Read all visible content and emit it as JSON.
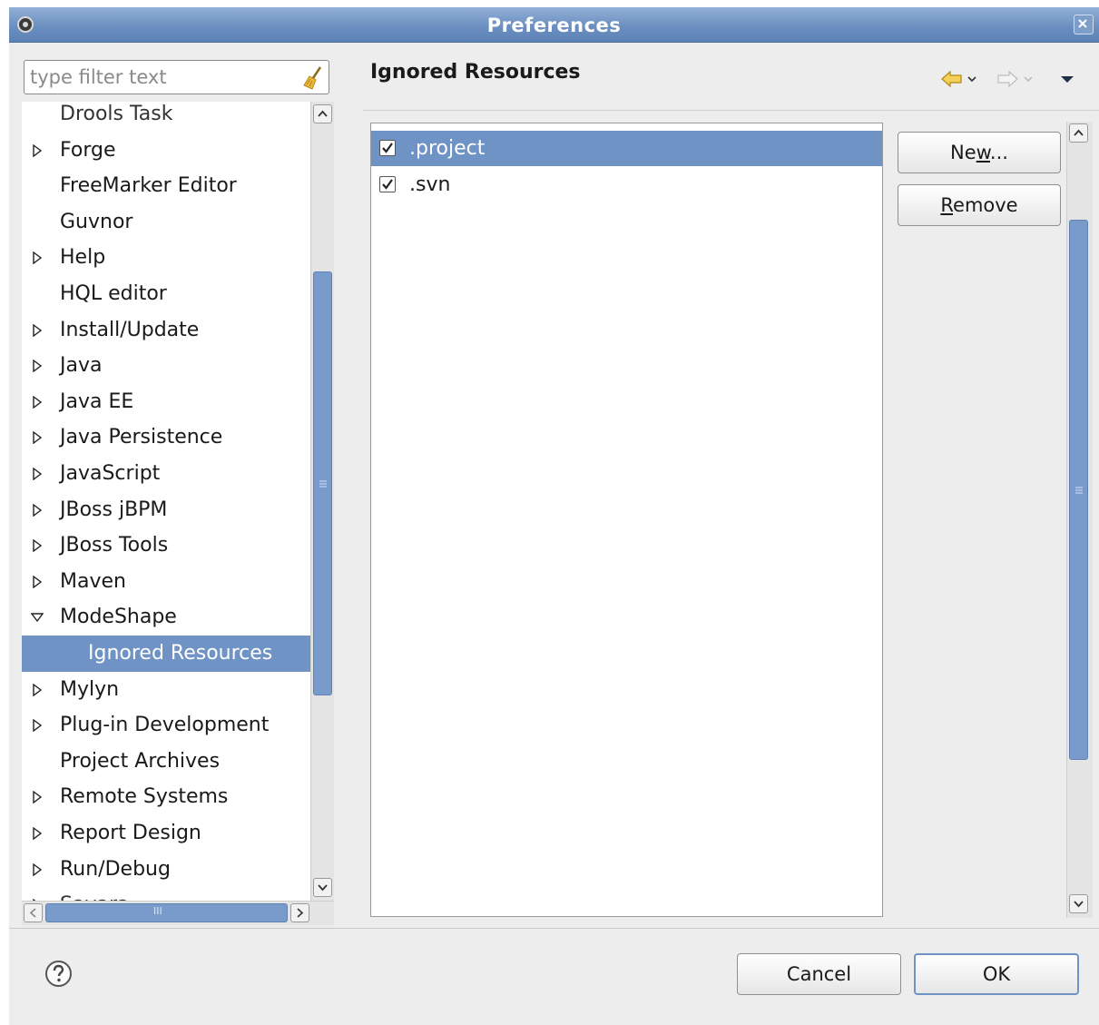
{
  "window": {
    "title": "Preferences"
  },
  "filter": {
    "placeholder": "type filter text"
  },
  "tree": {
    "items": [
      {
        "label": "Drools Task",
        "expander": "none",
        "state": "clipped-top"
      },
      {
        "label": "Forge",
        "expander": "collapsed"
      },
      {
        "label": "FreeMarker Editor",
        "expander": "none"
      },
      {
        "label": "Guvnor",
        "expander": "none"
      },
      {
        "label": "Help",
        "expander": "collapsed"
      },
      {
        "label": "HQL editor",
        "expander": "none"
      },
      {
        "label": "Install/Update",
        "expander": "collapsed"
      },
      {
        "label": "Java",
        "expander": "collapsed"
      },
      {
        "label": "Java EE",
        "expander": "collapsed"
      },
      {
        "label": "Java Persistence",
        "expander": "collapsed"
      },
      {
        "label": "JavaScript",
        "expander": "collapsed"
      },
      {
        "label": "JBoss jBPM",
        "expander": "collapsed"
      },
      {
        "label": "JBoss Tools",
        "expander": "collapsed"
      },
      {
        "label": "Maven",
        "expander": "collapsed"
      },
      {
        "label": "ModeShape",
        "expander": "expanded"
      },
      {
        "label": "Ignored Resources",
        "expander": "none",
        "child": true,
        "selected": true
      },
      {
        "label": "Mylyn",
        "expander": "collapsed"
      },
      {
        "label": "Plug-in Development",
        "expander": "collapsed"
      },
      {
        "label": "Project Archives",
        "expander": "none"
      },
      {
        "label": "Remote Systems",
        "expander": "collapsed"
      },
      {
        "label": "Report Design",
        "expander": "collapsed"
      },
      {
        "label": "Run/Debug",
        "expander": "collapsed"
      },
      {
        "label": "Savara",
        "expander": "collapsed",
        "state": "clipped-bottom"
      }
    ]
  },
  "page": {
    "title": "Ignored Resources",
    "nav": {
      "back_icon": "back-arrow-icon",
      "forward_icon": "forward-arrow-icon",
      "menu_icon": "view-menu-icon"
    }
  },
  "resources": [
    {
      "label": ".project",
      "checked": true,
      "selected": true
    },
    {
      "label": ".svn",
      "checked": true,
      "selected": false
    }
  ],
  "buttons": {
    "new": {
      "pre": "Ne",
      "mnemonic": "w",
      "post": "..."
    },
    "remove": {
      "pre": "",
      "mnemonic": "R",
      "post": "emove"
    },
    "cancel": "Cancel",
    "ok": "OK"
  },
  "scroll": {
    "hscroll_grip": "III"
  },
  "colors": {
    "selection": "#6f93c4",
    "titlebar": "#6b8fc0",
    "background": "#ededed"
  }
}
